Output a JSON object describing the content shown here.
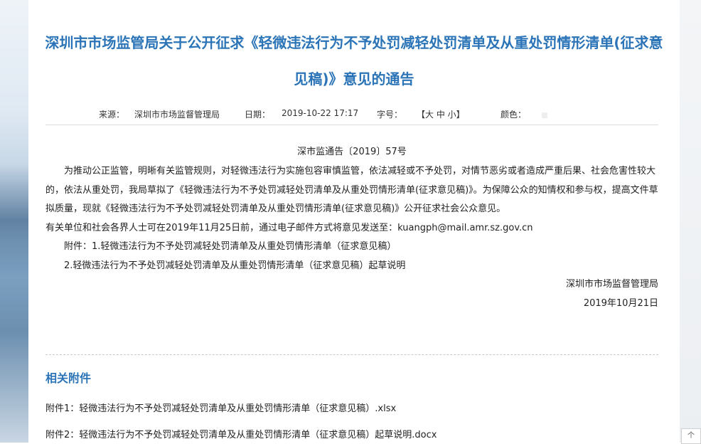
{
  "article": {
    "title": "深圳市市场监管局关于公开征求《轻微违法行为不予处罚减轻处罚清单及从重处罚情形清单(征求意见稿)》意见的通告",
    "meta": {
      "source_label": "来源：",
      "source_value": "深圳市市场监督管理局",
      "date_label": "日期：",
      "date_value": "2019-10-22 17:17",
      "fontsize_label": "字号：",
      "fontsize_options": "【大  中  小】",
      "color_label": "颜色：",
      "swatch_colors": [
        "#f6f0d8",
        "#f7e3c8",
        "#f5d3cd",
        "#e9f0d6",
        "#dfeedd",
        "#dbe9f5",
        "#e7e7ee",
        "#eeeeee"
      ]
    },
    "doc_number": "深市监通告〔2019〕57号",
    "paragraph1": "为推动公正监管，明晰有关监管规则，对轻微违法行为实施包容审慎监管，依法减轻或不予处罚，对情节恶劣或者造成严重后果、社会危害性较大的，依法从重处罚，我局草拟了《轻微违法行为不予处罚减轻处罚清单及从重处罚情形清单(征求意见稿)》。为保障公众的知情权和参与权，提高文件草拟质量，现就《轻微违法行为不予处罚减轻处罚清单及从重处罚情形清单(征求意见稿)》公开征求社会公众意见。",
    "paragraph2": "有关单位和社会各界人士可在2019年11月25日前，通过电子邮件方式将意见发送至：kuangph@mail.amr.sz.gov.cn",
    "attachment_line1": "附件：1.轻微违法行为不予处罚减轻处罚清单及从重处罚情形清单（征求意见稿）",
    "attachment_line2": "2.轻微违法行为不予处罚减轻处罚清单及从重处罚情形清单（征求意见稿）起草说明",
    "signature": "深圳市市场监督管理局",
    "sign_date": "2019年10月21日"
  },
  "related": {
    "heading": "相关附件",
    "files": [
      "附件1：轻微违法行为不予处罚减轻处罚清单及从重处罚情形清单（征求意见稿）.xlsx",
      "附件2：轻微违法行为不予处罚减轻处罚清单及从重处罚情形清单（征求意见稿）起草说明.docx"
    ]
  },
  "corner_widget": "个"
}
